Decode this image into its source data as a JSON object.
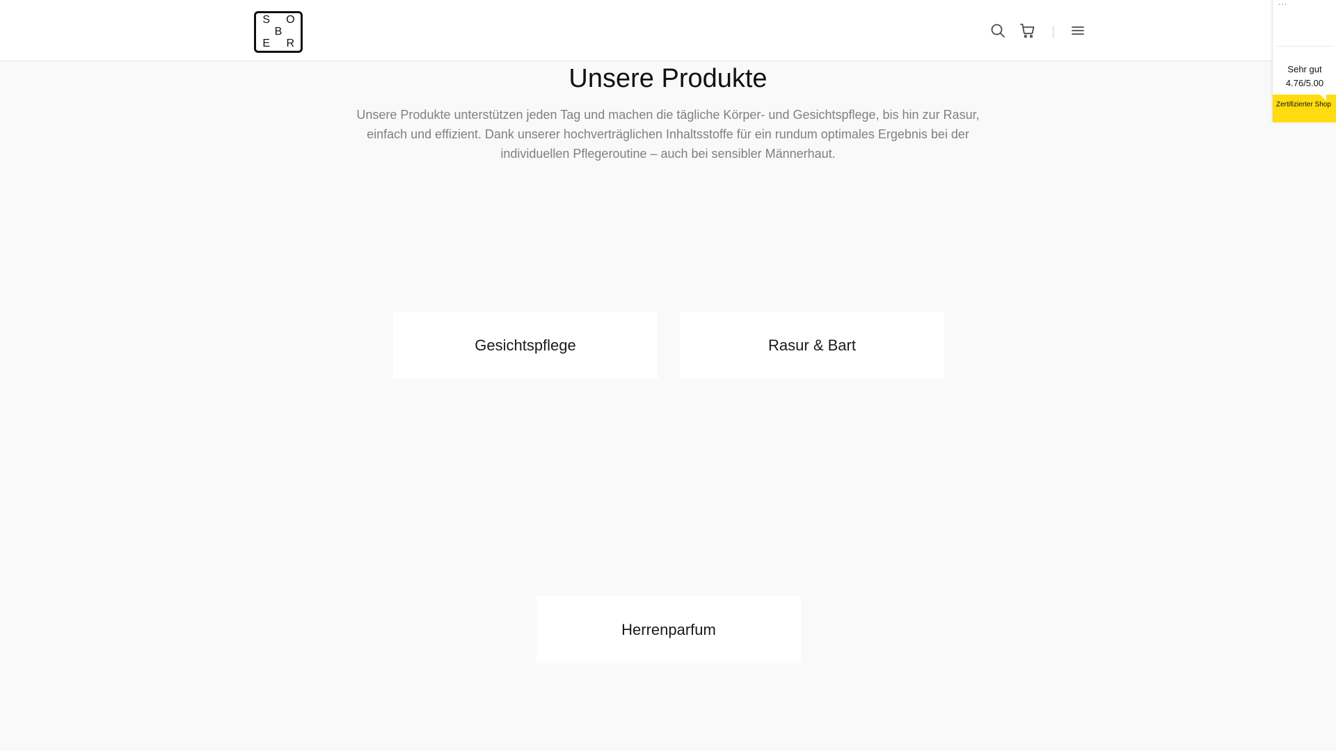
{
  "header": {
    "logo_letters": [
      "S",
      "O",
      "B",
      "E",
      "R"
    ],
    "icons": {
      "search": "search-icon",
      "cart": "cart-icon",
      "menu": "hamburger-menu-icon"
    }
  },
  "rating_widget": {
    "dots": "...",
    "label": "Sehr gut",
    "score": "4.76/5.00",
    "badge_text": "Zertifizierter Shop",
    "badge_color": "#ffdc0f"
  },
  "main": {
    "title": "Unsere Produkte",
    "intro": "Unsere Produkte unterstützen jeden Tag und machen die tägliche Körper- und Gesichtspflege, bis hin zur Rasur, einfach und effizient. Dank unserer hochverträglichen Inhaltsstoffe für ein rundum optimales Ergebnis bei der individuellen Pflegeroutine – auch bei sensibler Männerhaut.",
    "categories": [
      {
        "label": "Gesichtspflege"
      },
      {
        "label": "Rasur & Bart"
      },
      {
        "label": "Herrenparfum"
      }
    ]
  }
}
